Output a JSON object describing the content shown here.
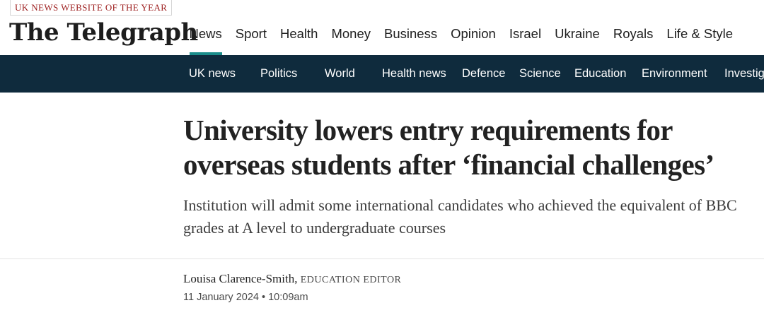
{
  "masthead": {
    "award": "UK NEWS WEBSITE OF THE YEAR",
    "logo": "The Telegraph"
  },
  "primary_nav": [
    "News",
    "Sport",
    "Health",
    "Money",
    "Business",
    "Opinion",
    "Israel",
    "Ukraine",
    "Royals",
    "Life & Style"
  ],
  "primary_nav_active": "News",
  "sub_nav": [
    "UK news",
    "Politics",
    "World",
    "Health news",
    "Defence",
    "Science",
    "Education",
    "Environment",
    "Investigations"
  ],
  "article": {
    "headline": "University lowers entry requirements for overseas students after ‘financial challenges’",
    "standfirst": "Institution will admit some international candidates who achieved the equivalent of BBC grades at A level to undergraduate courses",
    "author_name": "Louisa Clarence-Smith",
    "author_separator": ",",
    "author_role": "EDUCATION EDITOR",
    "date": "11 January 2024",
    "date_separator": "•",
    "time": "10:09am"
  },
  "colors": {
    "accent": "#1a8c8a",
    "sub_nav_background": "#0f2b3d",
    "award_text": "#9c1c1c"
  }
}
